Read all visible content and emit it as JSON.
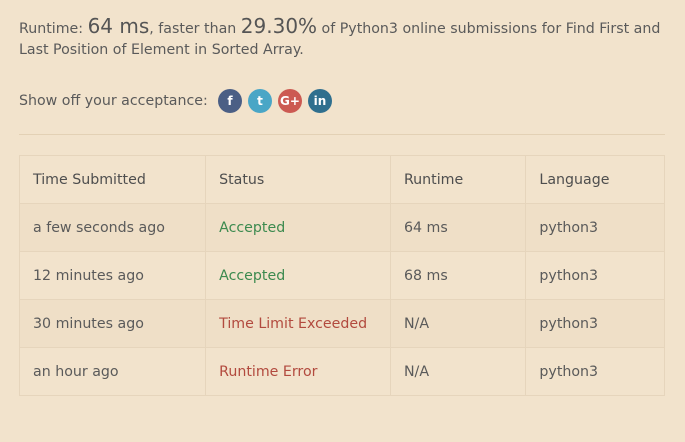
{
  "summary": {
    "runtime_prefix": "Runtime: ",
    "runtime_value": "64 ms",
    "faster_text": ", faster than ",
    "percent": "29.30%",
    "rest": " of Python3 online submissions for Find First and Last Position of Element in Sorted Array."
  },
  "share": {
    "label": "Show off your acceptance:",
    "icons": {
      "facebook": "f",
      "twitter": "t",
      "googleplus": "G+",
      "linkedin": "in"
    }
  },
  "table": {
    "headers": [
      "Time Submitted",
      "Status",
      "Runtime",
      "Language"
    ],
    "rows": [
      {
        "time": "a few seconds ago",
        "status": "Accepted",
        "runtime": "64 ms",
        "language": "python3"
      },
      {
        "time": "12 minutes ago",
        "status": "Accepted",
        "runtime": "68 ms",
        "language": "python3"
      },
      {
        "time": "30 minutes ago",
        "status": "Time Limit Exceeded",
        "runtime": "N/A",
        "language": "python3"
      },
      {
        "time": "an hour ago",
        "status": "Runtime Error",
        "runtime": "N/A",
        "language": "python3"
      }
    ]
  },
  "colors": {
    "background": "#f2e3cc",
    "accepted": "#3c8a4f",
    "failed": "#b24a3e"
  }
}
